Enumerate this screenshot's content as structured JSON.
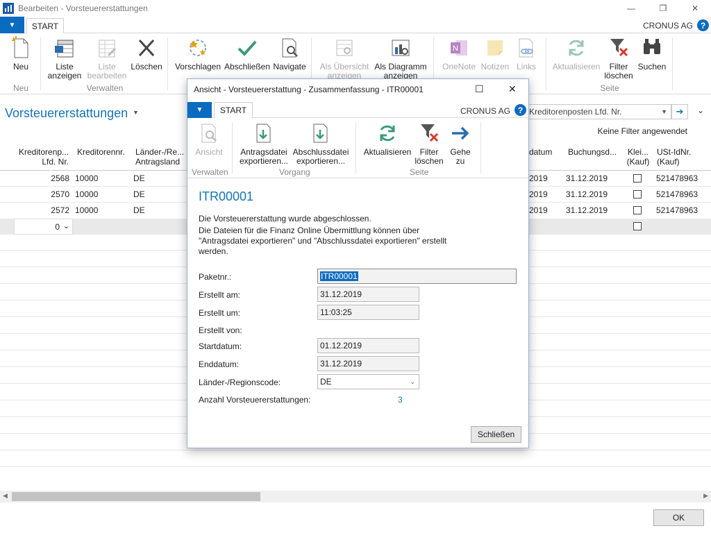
{
  "window": {
    "title": "Bearbeiten - Vorsteuererstattungen",
    "company": "CRONUS AG",
    "tab": "START",
    "minimize": "—",
    "restore": "❐",
    "close": "✕"
  },
  "ribbon": {
    "new": "Neu",
    "list_show_1": "Liste",
    "list_show_2": "anzeigen",
    "list_edit_1": "Liste",
    "list_edit_2": "bearbeiten",
    "delete": "Löschen",
    "suggest": "Vorschlagen",
    "finish": "Abschließen",
    "navigate": "Navigate",
    "overview_1": "Als Übersicht",
    "overview_2": "anzeigen",
    "diagram_1": "Als Diagramm",
    "diagram_2": "anzeigen",
    "onenote": "OneNote",
    "notes": "Notizen",
    "links": "Links",
    "refresh": "Aktualisieren",
    "filter_clear_1": "Filter",
    "filter_clear_2": "löschen",
    "search": "Suchen",
    "group_new": "Neu",
    "group_manage": "Verwalten",
    "group_page": "Seite"
  },
  "page": {
    "title": "Vorsteuererstattungen",
    "filter_field": "Kreditorenposten Lfd. Nr.",
    "no_filter": "Keine Filter angewendet"
  },
  "grid": {
    "headers": {
      "entry_no_1": "Kreditorenp...",
      "entry_no_2": "Lfd. Nr.",
      "vendor_no": "Kreditorennr.",
      "country_1": "Länder-/Re...",
      "country_2": "Antragsland",
      "end_date": "datum",
      "posting_date": "Buchungsd...",
      "small_1": "Klei...",
      "small_2": "(Kauf)",
      "vat_1": "USt-IdNr.",
      "vat_2": "(Kauf)"
    },
    "rows": [
      {
        "entry_no": "2568",
        "vendor_no": "10000",
        "country": "DE",
        "end_date": "2019",
        "posting_date": "31.12.2019",
        "vat": "521478963"
      },
      {
        "entry_no": "2570",
        "vendor_no": "10000",
        "country": "DE",
        "end_date": "2019",
        "posting_date": "31.12.2019",
        "vat": "521478963"
      },
      {
        "entry_no": "2572",
        "vendor_no": "10000",
        "country": "DE",
        "end_date": "2019",
        "posting_date": "31.12.2019",
        "vat": "521478963"
      }
    ],
    "new_row_value": "0"
  },
  "ok_label": "OK",
  "dialog": {
    "title": "Ansicht - Vorsteuererstattung - Zusammenfassung - ITR00001",
    "tab": "START",
    "company": "CRONUS AG",
    "ribbon": {
      "view": "Ansicht",
      "export_request_1": "Antragsdatei",
      "export_request_2": "exportieren...",
      "export_final_1": "Abschlussdatei",
      "export_final_2": "exportieren...",
      "refresh": "Aktualisieren",
      "filter_clear_1": "Filter",
      "filter_clear_2": "löschen",
      "goto_1": "Gehe",
      "goto_2": "zu",
      "group_manage": "Verwalten",
      "group_process": "Vorgang",
      "group_page": "Seite"
    },
    "heading": "ITR00001",
    "message_line1": "Die Vorsteuererstattung wurde abgeschlossen.",
    "message_line2": "Die Dateien für die Finanz Online Übermittlung können über",
    "message_line3": "\"Antragsdatei exportieren\" und \"Abschlussdatei exportieren\" erstellt",
    "message_line4": "werden.",
    "fields": {
      "package_label": "Paketnr.:",
      "package_value": "ITR00001",
      "created_date_label": "Erstellt am:",
      "created_date_value": "31.12.2019",
      "created_time_label": "Erstellt um:",
      "created_time_value": "11:03:25",
      "created_by_label": "Erstellt von:",
      "start_label": "Startdatum:",
      "start_value": "01.12.2019",
      "end_label": "Enddatum:",
      "end_value": "31.12.2019",
      "country_label": "Länder-/Regionscode:",
      "country_value": "DE",
      "count_label": "Anzahl Vorsteuererstattungen:",
      "count_value": "3"
    },
    "close_label": "Schließen"
  }
}
